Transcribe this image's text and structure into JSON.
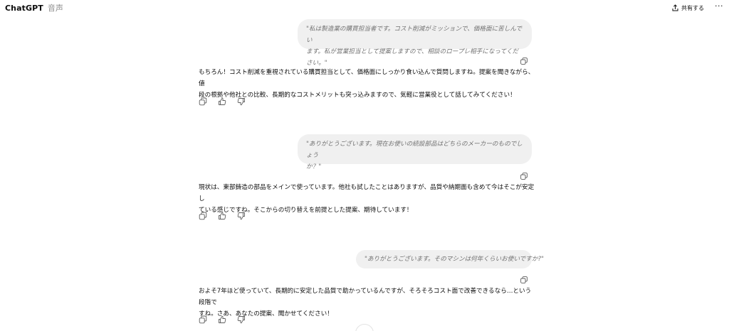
{
  "header": {
    "app_name": "ChatGPT",
    "mode_label": "音声",
    "share_label": "共有する",
    "more_label": "···",
    "share_icon": "share-icon"
  },
  "messages": [
    {
      "user": {
        "lines": [
          "\"私は製造業の購買担当者です。コスト削減がミッションで、価格面に苦しんでい",
          "ます。私が営業担当として提案しますので、相談のロープレ相手になってください。\""
        ]
      },
      "assistant": {
        "lines": [
          "もちろん！コスト削減を重視されている購買担当として、価格面にしっかり食い込んで質問しますね。提案を聞きながら、値",
          "段の根拠や他社との比較、長期的なコストメリットも突っ込みますので、気軽に営業役として話してみてください！"
        ]
      }
    },
    {
      "user": {
        "lines": [
          "\"ありがとうございます。現在お使いの続設部品はどちらのメーカーのものでしょう",
          "か？\""
        ]
      },
      "assistant": {
        "lines": [
          "現状は、東部鋳造の部品をメインで使っています。他社も試したことはありますが、品質や納期面も含めて今はそこが安定し",
          "ている感じですね。そこからの切り替えを前提とした提案、期待しています！"
        ]
      }
    },
    {
      "user": {
        "lines": [
          "\"ありがとうございます。そのマシンは何年くらいお使いですか?\""
        ]
      },
      "assistant": {
        "lines": [
          "およそ7年ほど使っていて、長期的に安定した品質で助かっているんですが、そろそろコスト面で改善できるなら…という段階で",
          "すね。さあ、あなたの提案、聞かせてください！"
        ]
      }
    }
  ],
  "icons": {
    "copy": "copy-icon",
    "thumbs_up": "thumbs-up-icon",
    "thumbs_down": "thumbs-down-icon",
    "scroll_down": "arrow-down-icon"
  }
}
